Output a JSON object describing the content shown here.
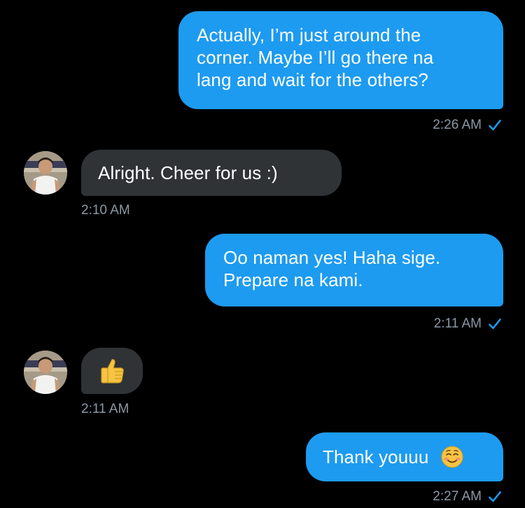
{
  "theme": {
    "background": "#000000",
    "outgoing_bubble": "#1d9bf0",
    "incoming_bubble": "#2f3336",
    "meta_text": "#8b98a5",
    "read_check": "#1d9bf0"
  },
  "messages": [
    {
      "direction": "outgoing",
      "lines": [
        "Actually, I’m just around the",
        "corner. Maybe I’ll go there na",
        "lang and wait for the others?"
      ],
      "time": "2:26 AM",
      "status_icon": "read-check-icon"
    },
    {
      "direction": "incoming",
      "text": "Alright. Cheer for us :)",
      "time": "2:10 AM",
      "avatar_icon": "avatar"
    },
    {
      "direction": "outgoing",
      "lines": [
        "Oo naman yes! Haha sige.",
        "Prepare na kami."
      ],
      "time": "2:11 AM",
      "status_icon": "read-check-icon"
    },
    {
      "direction": "incoming",
      "emoji_icon": "thumbs-up-emoji",
      "time": "2:11 AM",
      "avatar_icon": "avatar"
    },
    {
      "direction": "outgoing",
      "text": "Thank youuu",
      "emoji_icon": "smiling-face-emoji",
      "time": "2:27 AM",
      "status_icon": "read-check-icon"
    }
  ]
}
